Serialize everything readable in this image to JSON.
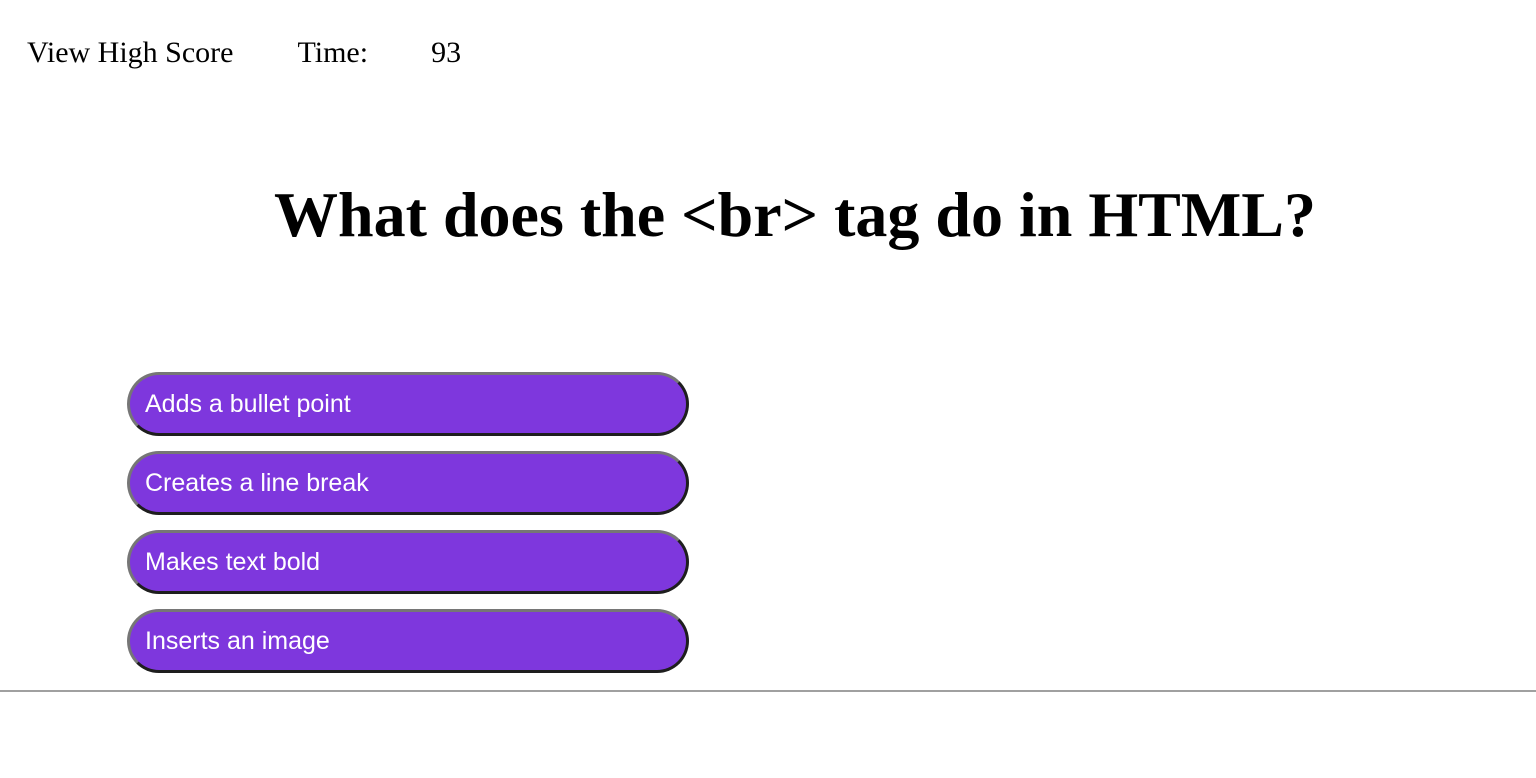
{
  "header": {
    "high_score_label": "View High Score",
    "time_label": "Time:",
    "time_value": "93"
  },
  "question": {
    "text": "What does the <br> tag do in HTML?"
  },
  "answers": [
    {
      "label": "Adds a bullet point"
    },
    {
      "label": "Creates a line break"
    },
    {
      "label": "Makes text bold"
    },
    {
      "label": "Inserts an image"
    }
  ],
  "colors": {
    "answer_button_bg": "#7e37dd",
    "answer_button_text": "#ffffff"
  }
}
